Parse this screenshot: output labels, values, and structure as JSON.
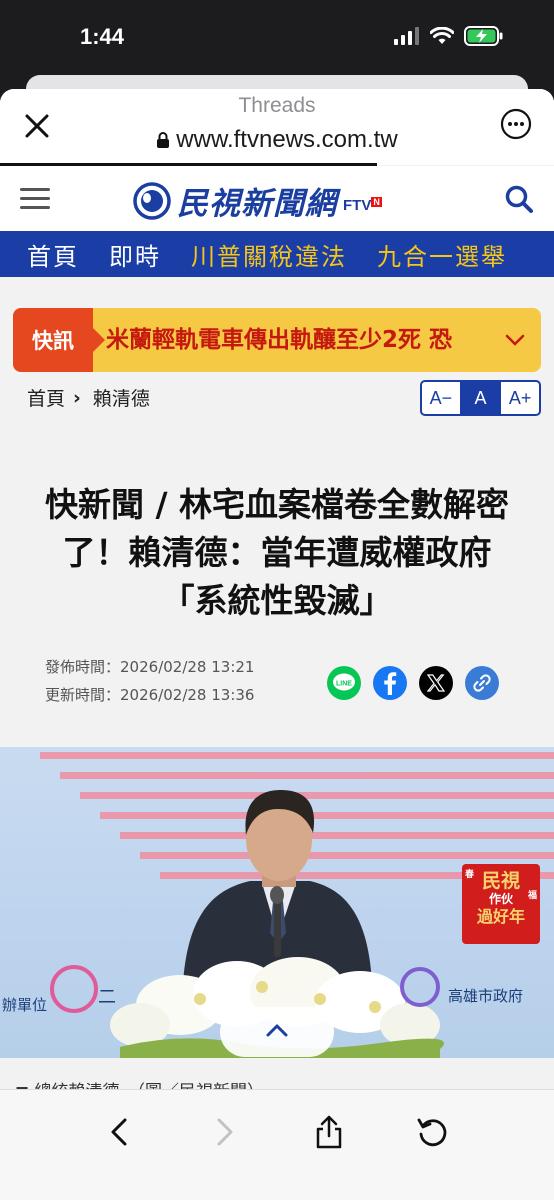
{
  "status_bar": {
    "time": "1:44"
  },
  "browser": {
    "app_name": "Threads",
    "url": "www.ftvnews.com.tw",
    "page_load_progress": 0.68
  },
  "site": {
    "logo_text": "民視新聞網",
    "logo_brand": "FTV",
    "logo_brand_mark": "N"
  },
  "nav": {
    "items": [
      {
        "label": "首頁",
        "color": "#ffffff"
      },
      {
        "label": "即時",
        "color": "#ffffff"
      },
      {
        "label": "川普關稅違法",
        "color": "#f5c518"
      },
      {
        "label": "九合一選舉",
        "color": "#f5c518"
      }
    ]
  },
  "breaking": {
    "label": "快訊",
    "text": "米蘭輕軌電車傳出軌釀至少2死 恐"
  },
  "breadcrumb": {
    "home": "首頁",
    "current": "賴清德"
  },
  "font_control": {
    "smaller": "A−",
    "normal": "A",
    "larger": "A+",
    "active": "normal"
  },
  "article": {
    "headline_lines": [
      "快新聞 / 林宅血案檔卷全數解密",
      "了！賴清德：當年遭威權政府",
      "「系統性毀滅」"
    ],
    "published_label": "發佈時間：",
    "published": "2026/02/28 13:21",
    "updated_label": "更新時間：",
    "updated": "2026/02/28 13:36",
    "share": [
      {
        "name": "LINE",
        "color": "#06c755"
      },
      {
        "name": "Facebook",
        "color": "#1877f2"
      },
      {
        "name": "X",
        "color": "#000000"
      },
      {
        "name": "link",
        "color": "#3a7bd5"
      }
    ],
    "photo": {
      "sponsor_left": "辦單位",
      "sponsor_mid": "二",
      "sponsor_right": "高雄市政府",
      "badge_line1": "民視",
      "badge_line2": "作伙",
      "badge_line3": "過好年",
      "badge_side_top": "春",
      "badge_side_bottom": "福"
    },
    "caption": "總統賴清德。（圖／民視新聞）"
  }
}
